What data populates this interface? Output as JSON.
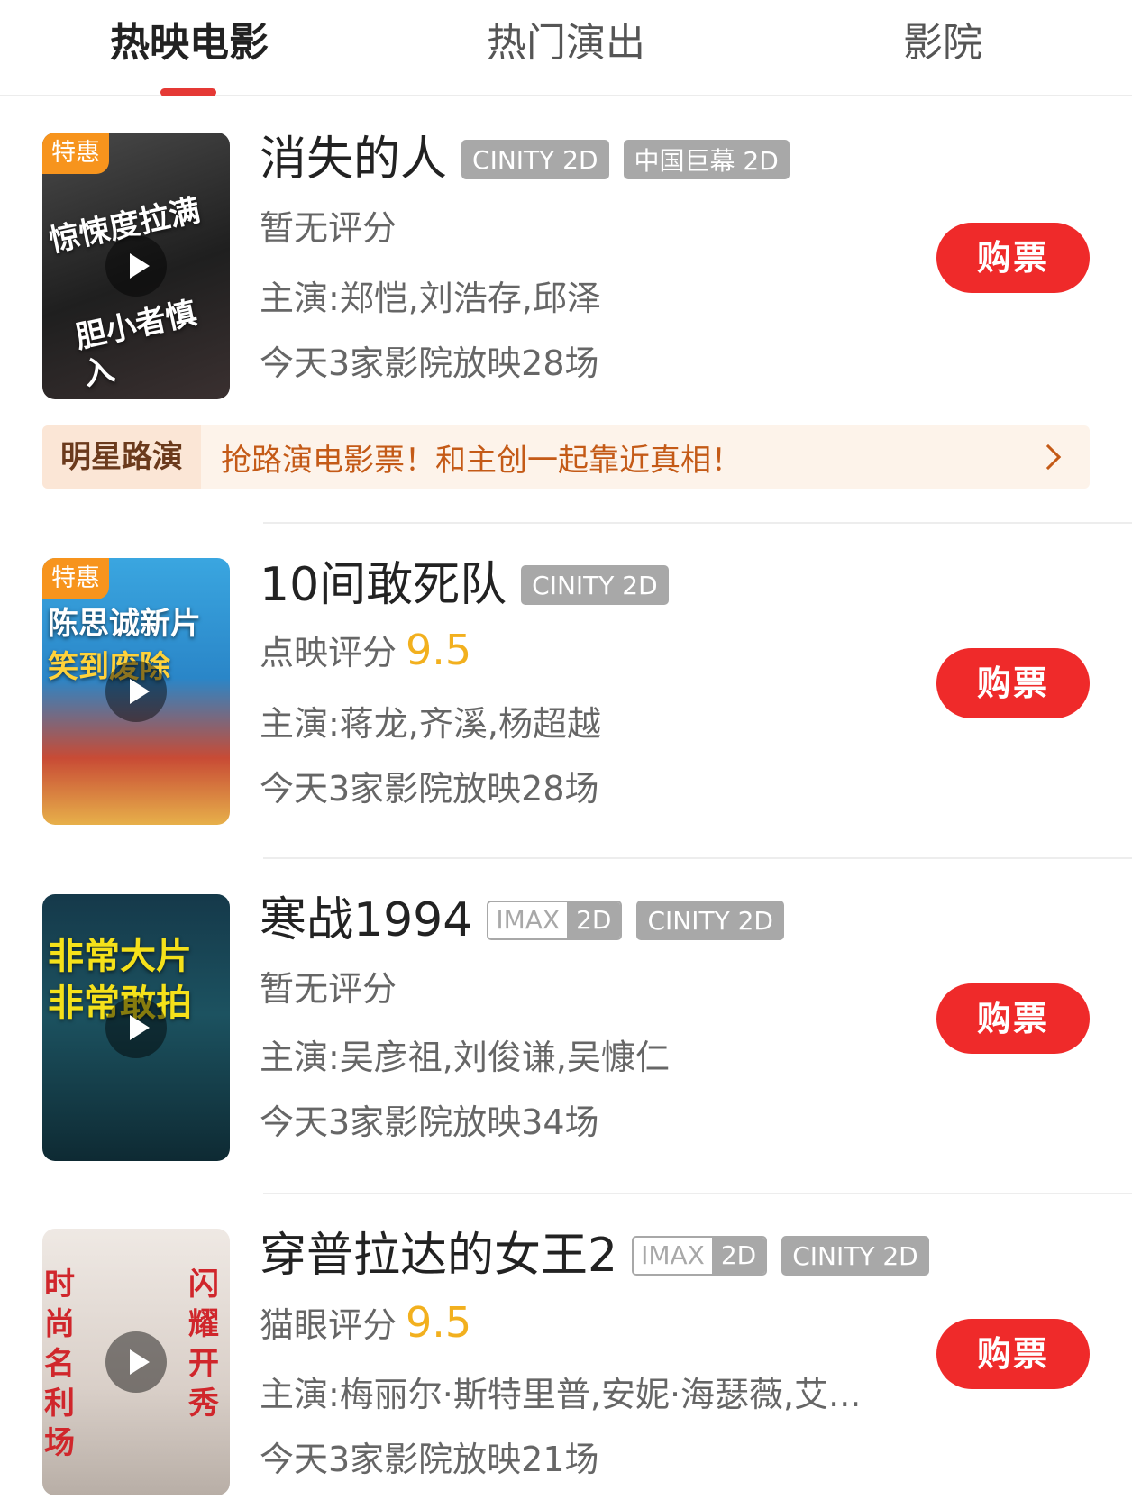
{
  "tabs": [
    {
      "label": "热映电影",
      "active": true
    },
    {
      "label": "热门演出",
      "active": false
    },
    {
      "label": "影院",
      "active": false
    }
  ],
  "colors": {
    "accent": "#ef2a2a",
    "score": "#f2b01e",
    "special_badge": "#f7941d",
    "tag_gray": "#a8a8a8"
  },
  "roadshow": {
    "label": "明星路演",
    "text": "抢路演电影票！和主创一起靠近真相！"
  },
  "movies": [
    {
      "title": "消失的人",
      "special": "特惠",
      "poster_text": [
        "惊悚度拉满",
        "胆小者慎入"
      ],
      "tags": [
        "CINITY 2D",
        "中国巨幕 2D"
      ],
      "score_label": "暂无评分",
      "score_value": "",
      "cast": "主演:郑恺,刘浩存,邱泽",
      "showings": "今天3家影院放映28场",
      "buy_label": "购票"
    },
    {
      "title": "10间敢死队",
      "special": "特惠",
      "poster_text": [
        "陈思诚新片",
        "笑到废除"
      ],
      "tags": [
        "CINITY 2D"
      ],
      "score_label": "点映评分",
      "score_value": "9.5",
      "cast": "主演:蒋龙,齐溪,杨超越",
      "showings": "今天3家影院放映28场",
      "buy_label": "购票"
    },
    {
      "title": "寒战1994",
      "special": "",
      "poster_text": [
        "非常大片",
        "非常敢拍"
      ],
      "imax_tag": {
        "imax": "IMAX",
        "d": "2D"
      },
      "tags": [
        "CINITY 2D"
      ],
      "score_label": "暂无评分",
      "score_value": "",
      "cast": "主演:吴彦祖,刘俊谦,吴慷仁",
      "showings": "今天3家影院放映34场",
      "buy_label": "购票"
    },
    {
      "title": "穿普拉达的女王2",
      "special": "",
      "poster_text": [
        "时尚名利场",
        "闪耀开秀"
      ],
      "imax_tag": {
        "imax": "IMAX",
        "d": "2D"
      },
      "tags": [
        "CINITY 2D"
      ],
      "score_label": "猫眼评分",
      "score_value": "9.5",
      "cast": "主演:梅丽尔·斯特里普,安妮·海瑟薇,艾...",
      "showings": "今天3家影院放映21场",
      "buy_label": "购票"
    }
  ]
}
